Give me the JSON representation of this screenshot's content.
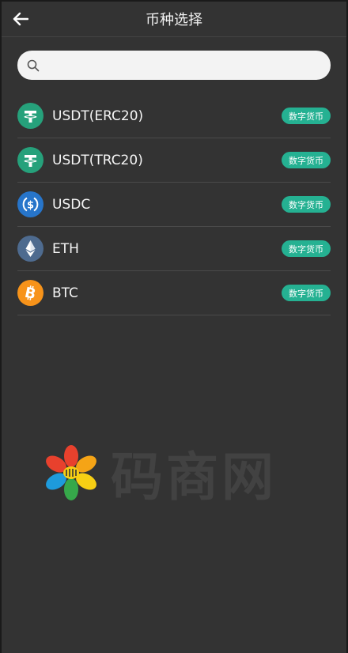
{
  "header": {
    "title": "币种选择"
  },
  "search": {
    "placeholder": ""
  },
  "coins": [
    {
      "name": "USDT(ERC20)",
      "tag": "数字货币",
      "icon": "tether-icon",
      "color": "#26a17b"
    },
    {
      "name": "USDT(TRC20)",
      "tag": "数字货币",
      "icon": "tether-icon",
      "color": "#26a17b"
    },
    {
      "name": "USDC",
      "tag": "数字货币",
      "icon": "usdc-icon",
      "color": "#2775ca"
    },
    {
      "name": "ETH",
      "tag": "数字货币",
      "icon": "ethereum-icon",
      "color": "#4e6b8f"
    },
    {
      "name": "BTC",
      "tag": "数字货币",
      "icon": "bitcoin-icon",
      "color": "#f7931a"
    }
  ],
  "watermark": {
    "text": "码商网"
  },
  "colors": {
    "background": "#333333",
    "tag": "#25b192",
    "search_bg": "#f3f3f3"
  }
}
